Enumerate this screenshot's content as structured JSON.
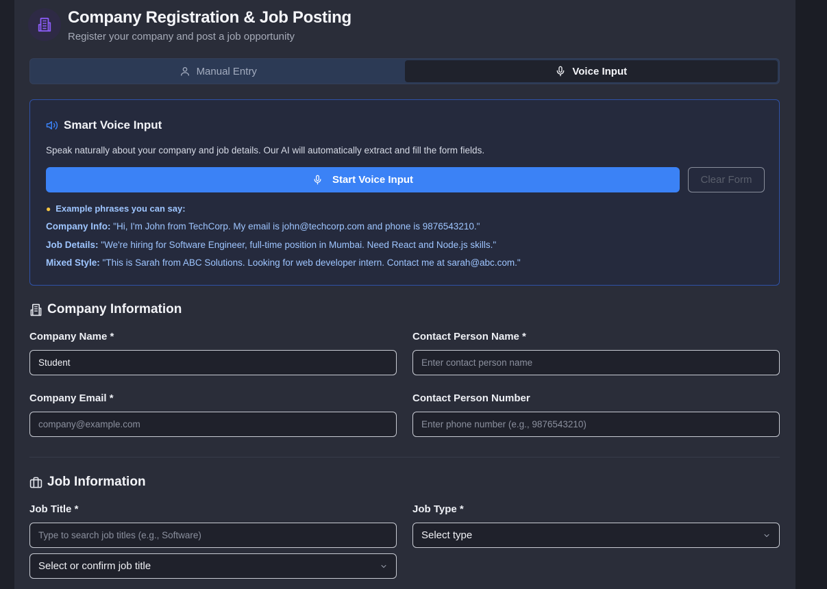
{
  "header": {
    "title": "Company Registration & Job Posting",
    "subtitle": "Register your company and post a job opportunity"
  },
  "tabs": [
    {
      "label": "Manual Entry",
      "icon": "user-icon",
      "active": false
    },
    {
      "label": "Voice Input",
      "icon": "mic-icon",
      "active": true
    }
  ],
  "voice": {
    "title": "Smart Voice Input",
    "description": "Speak naturally about your company and job details. Our AI will automatically extract and fill the form fields.",
    "start_label": "Start Voice Input",
    "clear_label": "Clear Form",
    "examples_heading": "Example phrases you can say:",
    "examples": [
      {
        "label": "Company Info:",
        "text": " \"Hi, I'm John from TechCorp. My email is john@techcorp.com and phone is 9876543210.\""
      },
      {
        "label": "Job Details:",
        "text": " \"We're hiring for Software Engineer, full-time position in Mumbai. Need React and Node.js skills.\""
      },
      {
        "label": "Mixed Style:",
        "text": " \"This is Sarah from ABC Solutions. Looking for web developer intern. Contact me at sarah@abc.com.\""
      }
    ]
  },
  "company": {
    "heading": "Company Information",
    "name_label": "Company Name *",
    "name_value": "Student",
    "contact_name_label": "Contact Person Name *",
    "contact_name_placeholder": "Enter contact person name",
    "email_label": "Company Email *",
    "email_placeholder": "company@example.com",
    "contact_number_label": "Contact Person Number",
    "contact_number_placeholder": "Enter phone number (e.g., 9876543210)"
  },
  "job": {
    "heading": "Job Information",
    "title_label": "Job Title *",
    "title_placeholder": "Type to search job titles (e.g., Software)",
    "title_select": "Select or confirm job title",
    "type_label": "Job Type *",
    "type_select": "Select type"
  },
  "colors": {
    "accent": "#3b82f6",
    "hint_text": "#9ec5ff",
    "panel": "#2a2d39",
    "logo_icon": "#8b5cf6"
  }
}
